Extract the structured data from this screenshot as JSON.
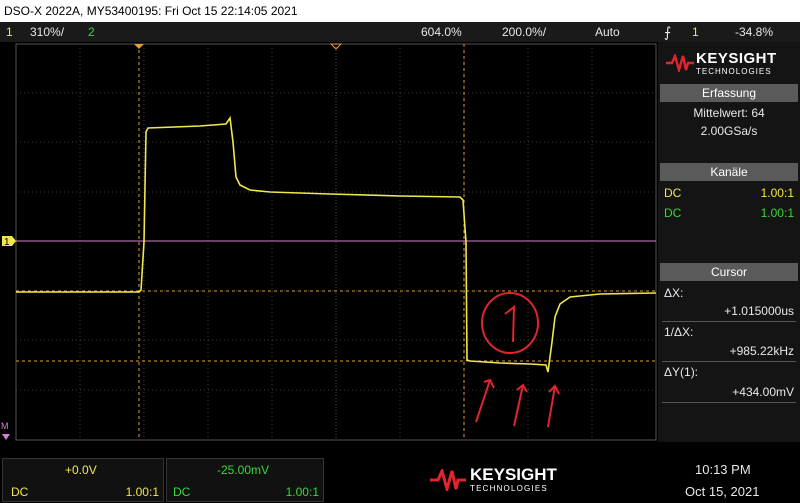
{
  "title_bar": "DSO-X 2022A, MY53400195: Fri Oct 15 22:14:05 2021",
  "top_bar": {
    "ch1_num": "1",
    "ch1_scale": "310%/",
    "ch2_num": "2",
    "timebase": "604.0%",
    "time_div": "200.0%/",
    "trigger_mode": "Auto",
    "trig_icon": "trigger-edge-icon",
    "trig_channel": "1",
    "trig_level": "-34.8%"
  },
  "brand": {
    "name": "KEYSIGHT",
    "sub": "TECHNOLOGIES"
  },
  "erfassung": {
    "header": "Erfassung",
    "mode": "Mittelwert: 64",
    "rate": "2.00GSa/s"
  },
  "kanaele": {
    "header": "Kanäle",
    "ch1": {
      "coupling": "DC",
      "ratio": "1.00:1"
    },
    "ch2": {
      "coupling": "DC",
      "ratio": "1.00:1"
    }
  },
  "cursor": {
    "header": "Cursor",
    "dx_label": "ΔX:",
    "dx_value": "+1.015000us",
    "inv_label": "1/ΔX:",
    "inv_value": "+985.22kHz",
    "dy_label": "ΔY(1):",
    "dy_value": "+434.00mV"
  },
  "bottom": {
    "ch1_offset": "+0.0V",
    "ch1_coupling": "DC",
    "ch1_ratio": "1.00:1",
    "ch2_offset": "-25.00mV",
    "ch2_coupling": "DC",
    "ch2_ratio": "1.00:1",
    "time": "10:13 PM",
    "date": "Oct 15, 2021"
  },
  "annotation": {
    "label": "1"
  },
  "screen_markers": {
    "ground_marker": "1",
    "math_marker": "M"
  },
  "colors": {
    "ch1": "#f0e84a",
    "ch2": "#3ad63a",
    "cursor": "#e0a030",
    "ref": "#d080d0",
    "annotation": "#e0252f"
  }
}
